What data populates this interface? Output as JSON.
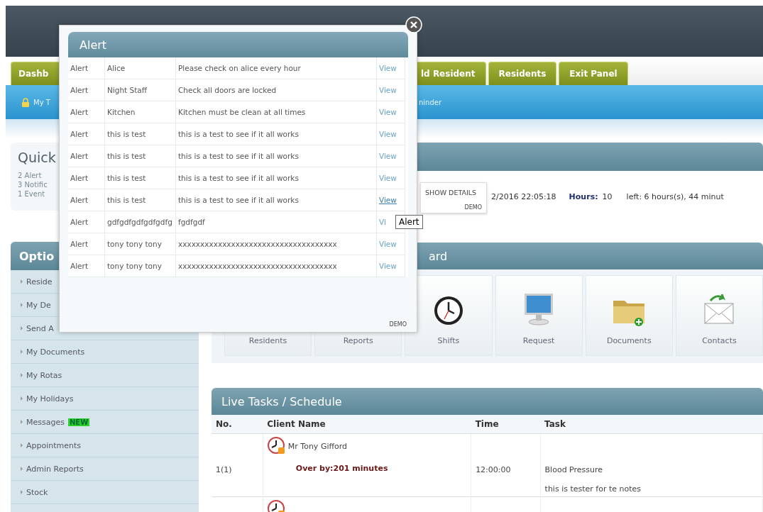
{
  "tabs": [
    {
      "label": "Dashb"
    },
    {
      "label": "ld Resident"
    },
    {
      "label": "Residents"
    },
    {
      "label": "Exit Panel"
    }
  ],
  "nav_bar": {
    "left_item": "My T",
    "right_item": "ninder"
  },
  "quick_panel": {
    "title": "Quick",
    "links": [
      "2 Alert",
      "3 Notific",
      "1 Event"
    ]
  },
  "info_line": {
    "date": "2/2016 22:05:18",
    "hours_label": "Hours:",
    "hours_value": "10",
    "time_left": "left: 6 hours(s), 44 minut"
  },
  "options_panel": {
    "title": "Optio",
    "items": [
      {
        "label": "Reside"
      },
      {
        "label": "My De"
      },
      {
        "label": "Send A"
      },
      {
        "label": "My Documents"
      },
      {
        "label": "My Rotas"
      },
      {
        "label": "My Holidays"
      },
      {
        "label": "Messages",
        "badge": "NEW"
      },
      {
        "label": "Appointments"
      },
      {
        "label": "Admin Reports"
      },
      {
        "label": "Stock"
      }
    ]
  },
  "dashboard_panel": {
    "title": "ard",
    "tiles": [
      {
        "label": "Residents",
        "kind": "covered"
      },
      {
        "label": "Reports",
        "kind": "covered"
      },
      {
        "label": "Shifts",
        "kind": "clock"
      },
      {
        "label": "Request",
        "kind": "monitor"
      },
      {
        "label": "Documents",
        "kind": "folder"
      },
      {
        "label": "Contacts",
        "kind": "envelope"
      }
    ]
  },
  "tasks_panel": {
    "title": "Live Tasks / Schedule",
    "columns": [
      "No.",
      "Client Name",
      "Time",
      "Task"
    ],
    "rows": [
      {
        "no": "1(1)",
        "client": "Mr Tony Gifford",
        "status": "Over by:201 minutes",
        "time": "12:00:00",
        "task": "Blood Pressure",
        "notes": "this is tester for te notes"
      }
    ]
  },
  "alert_dialog": {
    "title": "Alert",
    "footer": "DEMO",
    "rows": [
      {
        "type": "Alert",
        "name": "Alice",
        "message": "Please check on alice every hour",
        "view": "View",
        "hovered": false
      },
      {
        "type": "Alert",
        "name": "Night Staff",
        "message": "Check all doors are locked",
        "view": "View",
        "hovered": false
      },
      {
        "type": "Alert",
        "name": "Kitchen",
        "message": "Kitchen must be clean at all times",
        "view": "View",
        "hovered": false
      },
      {
        "type": "Alert",
        "name": "this is test",
        "message": "this is a test to see if it all works",
        "view": "View",
        "hovered": false
      },
      {
        "type": "Alert",
        "name": "this is test",
        "message": "this is a test to see if it all works",
        "view": "View",
        "hovered": false
      },
      {
        "type": "Alert",
        "name": "this is test",
        "message": "this is a test to see if it all works",
        "view": "View",
        "hovered": false
      },
      {
        "type": "Alert",
        "name": "this is test",
        "message": "this is a test to see if it all works",
        "view": "View",
        "hovered": true
      },
      {
        "type": "Alert",
        "name": "gdfgdfgdfgdfgdfg",
        "message": "fgdfgdf",
        "view": "Vi",
        "hovered": false
      },
      {
        "type": "Alert",
        "name": "tony tony tony",
        "message": "xxxxxxxxxxxxxxxxxxxxxxxxxxxxxxxxxxxx",
        "view": "View",
        "hovered": false
      },
      {
        "type": "Alert",
        "name": "tony tony tony",
        "message": "xxxxxxxxxxxxxxxxxxxxxxxxxxxxxxxxxxxx",
        "view": "View",
        "hovered": false
      }
    ]
  },
  "details_tooltip": {
    "label": "SHOW DETAILS",
    "footer": "DEMO"
  },
  "title_tooltip": {
    "label": "Alert"
  }
}
